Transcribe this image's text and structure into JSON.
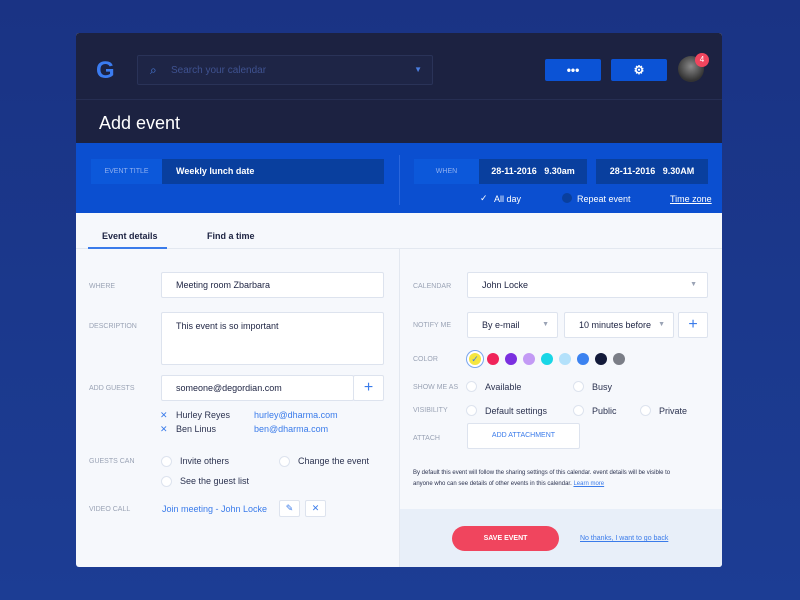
{
  "header": {
    "logo": "G",
    "search_placeholder": "Search your calendar",
    "more_label": "•••",
    "settings_icon": "⚙",
    "badge_count": "4",
    "title": "Add event"
  },
  "event": {
    "title_label": "EVENT TITLE",
    "title_value": "Weekly lunch date",
    "when_label": "WHEN",
    "start": "28-11-2016   9.30am",
    "end": "28-11-2016   9.30AM",
    "all_day": "All day",
    "repeat": "Repeat event",
    "time_zone": "Time zone"
  },
  "tabs": [
    "Event details",
    "Find a time"
  ],
  "left": {
    "where_label": "WHERE",
    "where_value": "Meeting room Zbarbara",
    "description_label": "DESCRIPTION",
    "description_value": "This event is so important",
    "guests_label": "ADD GUESTS",
    "guests_input": "someone@degordian.com",
    "guests": [
      {
        "name": "Hurley Reyes",
        "email": "hurley@dharma.com"
      },
      {
        "name": "Ben Linus",
        "email": "ben@dharma.com"
      }
    ],
    "guests_can_label": "GUESTS CAN",
    "guests_can": [
      "Invite others",
      "Change the event",
      "See the guest list"
    ],
    "video_label": "VIDEO CALL",
    "video_link": "Join meeting - John Locke"
  },
  "right": {
    "calendar_label": "CALENDAR",
    "calendar_value": "John Locke",
    "notify_label": "NOTIFY ME",
    "notify_method": "By e-mail",
    "notify_time": "10 minutes before",
    "color_label": "COLOR",
    "colors": [
      "#f5e642",
      "#f0245a",
      "#7b2fe0",
      "#c39af5",
      "#19d6e6",
      "#b3e1fb",
      "#3b82f0",
      "#131a3a",
      "#7b7e87"
    ],
    "show_label": "SHOW ME AS",
    "show_options": [
      "Available",
      "Busy"
    ],
    "visibility_label": "VISIBILITY",
    "visibility_options": [
      "Default settings",
      "Public",
      "Private"
    ],
    "attach_label": "ATTACH",
    "attach_button": "ADD ATTACHMENT",
    "note": "By default this event will follow the sharing settings of this calendar. event details will be visible to anyone who can see details of other events in this calendar.",
    "learn_more": "Learn more"
  },
  "footer": {
    "save": "SAVE EVENT",
    "cancel": "No thanks, I want to go back"
  }
}
